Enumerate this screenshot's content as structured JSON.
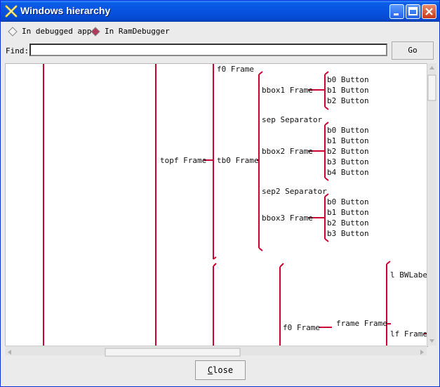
{
  "window": {
    "title": "Windows hierarchy"
  },
  "options": {
    "debugged_app_label": "In debugged app",
    "ramdebugger_label": "In RamDebugger",
    "selected": "ramdebugger"
  },
  "find": {
    "label": "Find:",
    "value": "",
    "go_label": "Go"
  },
  "tree_labels": {
    "topf": "topf Frame",
    "f0": "f0 Frame",
    "tb0": "tb0 Frame",
    "bbox1": "bbox1 Frame",
    "bbox1_b0": "b0 Button",
    "bbox1_b1": "b1 Button",
    "bbox1_b2": "b2 Button",
    "sep": "sep Separator",
    "bbox2": "bbox2 Frame",
    "bbox2_b0": "b0 Button",
    "bbox2_b1": "b1 Button",
    "bbox2_b2": "b2 Button",
    "bbox2_b3": "b3 Button",
    "bbox2_b4": "b4 Button",
    "sep2": "sep2 Separator",
    "bbox3": "bbox3 Frame",
    "bbox3_b0": "b0 Button",
    "bbox3_b1": "b1 Button",
    "bbox3_b2": "b2 Button",
    "bbox3_b3": "b3 Button",
    "f0_lower": "f0 Frame",
    "frame": "frame Frame",
    "l_bwlabel": "l BWLabel",
    "lf": "lf Frame"
  },
  "buttons": {
    "close_label": "Close",
    "close_mnemonic": "C",
    "close_rest": "lose"
  },
  "colors": {
    "tree_line": "#cc0033",
    "titlebar": "#0653e0"
  },
  "icons": {
    "app": "x-logo-icon",
    "minimize": "minimize-icon",
    "maximize": "maximize-icon",
    "close": "close-icon"
  }
}
